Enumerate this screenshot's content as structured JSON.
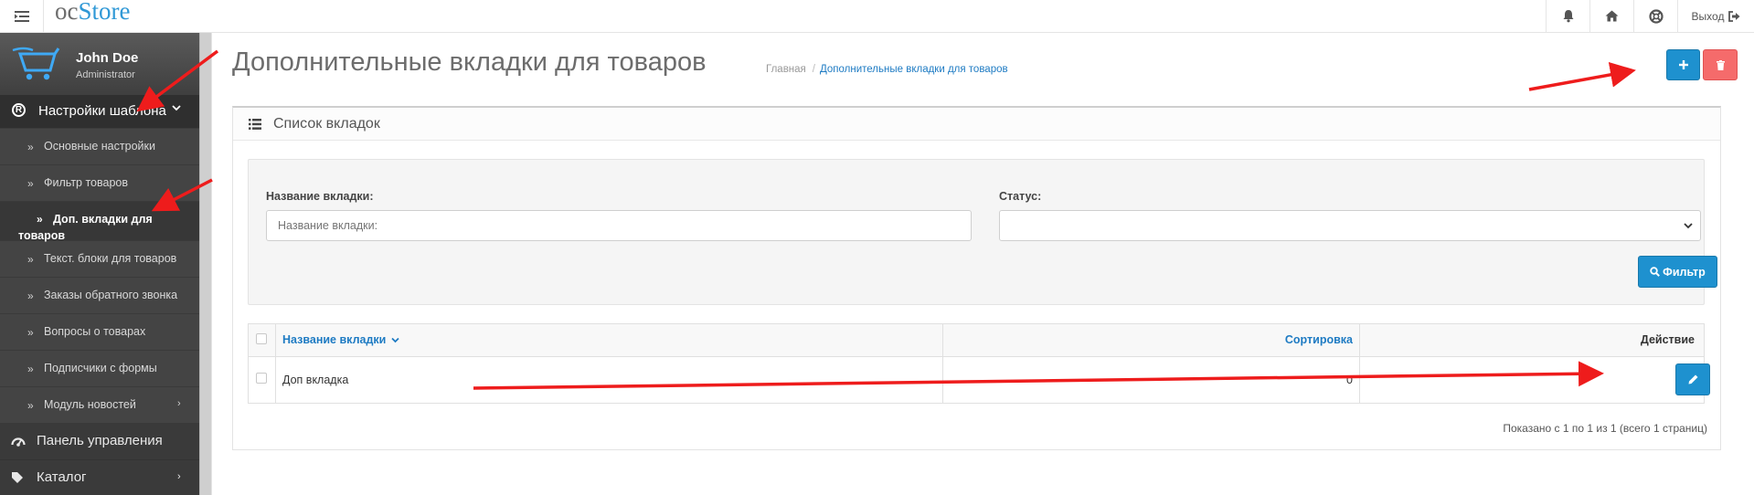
{
  "header": {
    "logo_oc": "oc",
    "logo_store": "Store",
    "logout_label": "Выход"
  },
  "sidebar": {
    "user_name": "John Doe",
    "user_role": "Administrator",
    "section_label": "Настройки шаблона",
    "items": [
      {
        "label": "Основные настройки"
      },
      {
        "label": "Фильтр товаров"
      },
      {
        "label": "Доп. вкладки для товаров"
      },
      {
        "label": "Текст. блоки для товаров"
      },
      {
        "label": "Заказы обратного звонка"
      },
      {
        "label": "Вопросы о товарах"
      },
      {
        "label": "Подписчики с формы"
      },
      {
        "label": "Модуль новостей"
      }
    ],
    "main_items": [
      {
        "label": "Панель управления"
      },
      {
        "label": "Каталог"
      }
    ]
  },
  "page": {
    "title": "Дополнительные вкладки для товаров",
    "breadcrumb": [
      "Главная",
      "Дополнительные вкладки для товаров"
    ]
  },
  "panel": {
    "title": "Список вкладок",
    "filter": {
      "name_label": "Название вкладки:",
      "name_placeholder": "Название вкладки:",
      "name_value": "",
      "status_label": "Статус:",
      "status_value": "",
      "filter_button": "Фильтр"
    },
    "table": {
      "columns": [
        "Название вкладки",
        "Сортировка",
        "Действие"
      ],
      "rows": [
        {
          "name": "Доп вкладка",
          "sort": "0"
        }
      ]
    },
    "pagination_info": "Показано с 1 по 1 из 1 (всего 1 страниц)"
  },
  "colors": {
    "primary": "#1e91cf",
    "danger": "#f56b6b",
    "sidebar": "#444444",
    "annotation_arrow": "#ee1c1c"
  }
}
